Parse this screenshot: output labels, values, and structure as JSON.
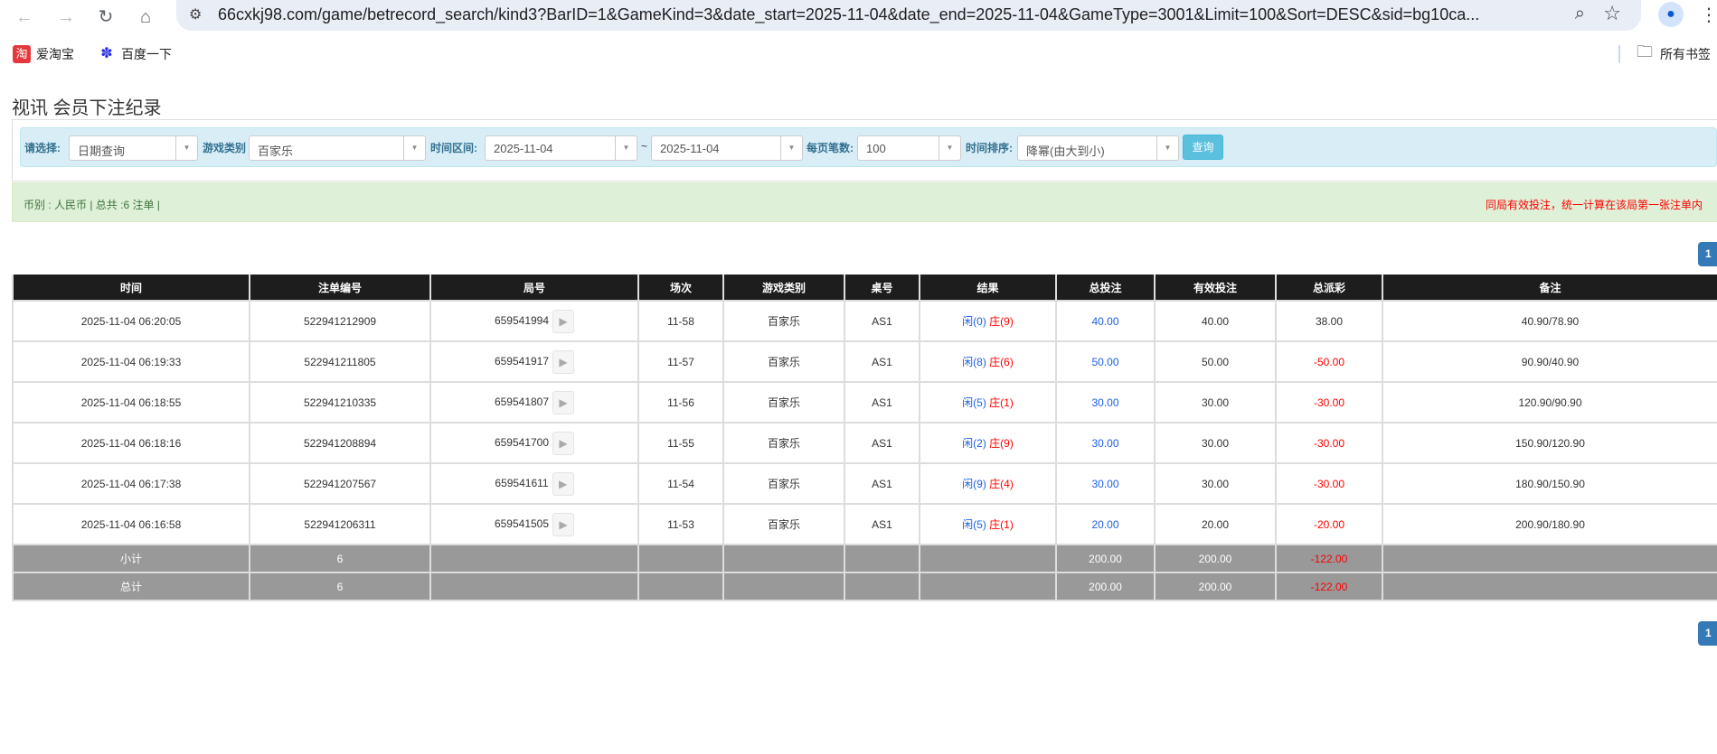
{
  "browser": {
    "url": "66cxkj98.com/game/betrecord_search/kind3?BarID=1&GameKind=3&date_start=2025-11-04&date_end=2025-11-04&GameType=3001&Limit=100&Sort=DESC&sid=bg10ca...",
    "bookmarks": [
      {
        "label": "爱淘宝",
        "icon": "taobao-icon",
        "color": "#e4393c"
      },
      {
        "label": "百度一下",
        "icon": "baidu-paw-icon",
        "color": "#2932e1"
      }
    ],
    "all_bookmarks": "所有书签"
  },
  "page": {
    "title": "视讯 会员下注纪录",
    "filters": {
      "select_label": "请选择:",
      "select_value": "日期查询",
      "game_type_label": "游戏类别",
      "game_type_value": "百家乐",
      "range_label": "时间区间:",
      "date_start": "2025-11-04",
      "range_sep": "~",
      "date_end": "2025-11-04",
      "per_page_label": "每页笔数:",
      "per_page_value": "100",
      "sort_label": "时间排序:",
      "sort_value": "降幂(由大到小)",
      "query_button": "查询"
    },
    "info": {
      "summary": "币别 : 人民币 | 总共 :6 注单 |",
      "notice": "同局有效投注，统一计算在该局第一张注单内"
    },
    "pagination": {
      "current": "1"
    },
    "table": {
      "headers": [
        "时间",
        "注单编号",
        "局号",
        "场次",
        "游戏类别",
        "桌号",
        "结果",
        "总投注",
        "有效投注",
        "总派彩",
        "备注"
      ],
      "rows": [
        {
          "time": "2025-11-04 06:20:05",
          "bet_id": "522941212909",
          "round": "659541994",
          "session": "11-58",
          "game": "百家乐",
          "table": "AS1",
          "player": "闲(0)",
          "banker": "庄(9)",
          "bet": "40.00",
          "valid": "40.00",
          "payout": "38.00",
          "payout_negative": false,
          "note": "40.90/78.90"
        },
        {
          "time": "2025-11-04 06:19:33",
          "bet_id": "522941211805",
          "round": "659541917",
          "session": "11-57",
          "game": "百家乐",
          "table": "AS1",
          "player": "闲(8)",
          "banker": "庄(6)",
          "bet": "50.00",
          "valid": "50.00",
          "payout": "-50.00",
          "payout_negative": true,
          "note": "90.90/40.90"
        },
        {
          "time": "2025-11-04 06:18:55",
          "bet_id": "522941210335",
          "round": "659541807",
          "session": "11-56",
          "game": "百家乐",
          "table": "AS1",
          "player": "闲(5)",
          "banker": "庄(1)",
          "bet": "30.00",
          "valid": "30.00",
          "payout": "-30.00",
          "payout_negative": true,
          "note": "120.90/90.90"
        },
        {
          "time": "2025-11-04 06:18:16",
          "bet_id": "522941208894",
          "round": "659541700",
          "session": "11-55",
          "game": "百家乐",
          "table": "AS1",
          "player": "闲(2)",
          "banker": "庄(9)",
          "bet": "30.00",
          "valid": "30.00",
          "payout": "-30.00",
          "payout_negative": true,
          "note": "150.90/120.90"
        },
        {
          "time": "2025-11-04 06:17:38",
          "bet_id": "522941207567",
          "round": "659541611",
          "session": "11-54",
          "game": "百家乐",
          "table": "AS1",
          "player": "闲(9)",
          "banker": "庄(4)",
          "bet": "30.00",
          "valid": "30.00",
          "payout": "-30.00",
          "payout_negative": true,
          "note": "180.90/150.90"
        },
        {
          "time": "2025-11-04 06:16:58",
          "bet_id": "522941206311",
          "round": "659541505",
          "session": "11-53",
          "game": "百家乐",
          "table": "AS1",
          "player": "闲(5)",
          "banker": "庄(1)",
          "bet": "20.00",
          "valid": "20.00",
          "payout": "-20.00",
          "payout_negative": true,
          "note": "200.90/180.90"
        }
      ],
      "subtotal": {
        "label": "小计",
        "count": "6",
        "bet": "200.00",
        "valid": "200.00",
        "payout": "-122.00"
      },
      "total": {
        "label": "总计",
        "count": "6",
        "bet": "200.00",
        "valid": "200.00",
        "payout": "-122.00"
      }
    }
  },
  "colors": {
    "header_bg": "#1d1d1d",
    "sum_bg": "#999999",
    "filter_bg": "#d9edf7",
    "info_bg": "#dff0d8",
    "accent": "#337ab7",
    "player": "#1a5fe6",
    "banker": "#ff0000"
  }
}
